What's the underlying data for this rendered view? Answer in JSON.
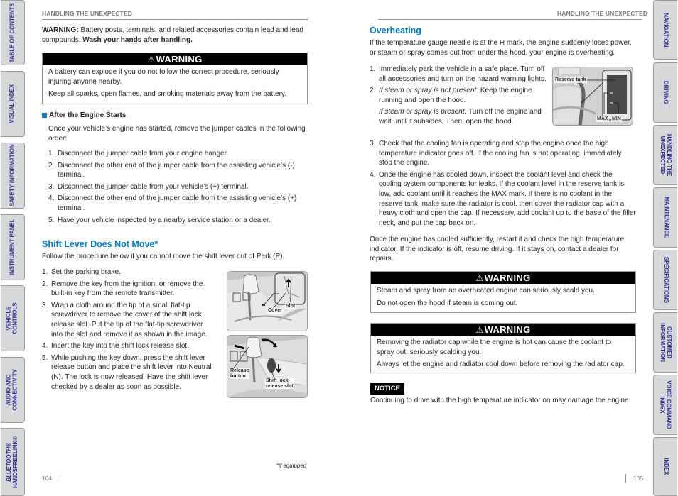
{
  "left_tabs": [
    {
      "label": "TABLE OF CONTENTS"
    },
    {
      "label": "VISUAL INDEX"
    },
    {
      "label": "SAFETY INFORMATION"
    },
    {
      "label": "INSTRUMENT PANEL"
    },
    {
      "label": "VEHICLE\nCONTROLS"
    },
    {
      "label": "AUDIO AND\nCONNECTIVITY"
    },
    {
      "label_italic": "BLUETOOTH®",
      "label": "HANDSFREELINK®"
    }
  ],
  "right_tabs": [
    {
      "label": "NAVIGATION"
    },
    {
      "label": "DRIVING"
    },
    {
      "label": "HANDLING THE\nUNEXPECTED"
    },
    {
      "label": "MAINTENANCE"
    },
    {
      "label": "SPECIFICATIONS"
    },
    {
      "label": "CUSTOMER\nINFORMATION"
    },
    {
      "label": "VOICE COMMAND\nINDEX"
    },
    {
      "label": "INDEX"
    }
  ],
  "left_page": {
    "running_head": "HANDLING THE UNEXPECTED",
    "prop65": {
      "lead": "WARNING:",
      "text": " Battery posts, terminals, and related accessories contain lead and lead compounds. ",
      "bold_tail": "Wash your hands after handling."
    },
    "warning_box": {
      "icon": "⚠",
      "title": "WARNING",
      "lines": [
        "A battery can explode if you do not follow the correct procedure, seriously injuring anyone nearby.",
        "Keep all sparks, open flames, and smoking materials away from the battery."
      ]
    },
    "after_start": {
      "heading": "After the Engine Starts",
      "intro": "Once your vehicle’s engine has started, remove the jumper cables in the following order:",
      "steps": [
        "Disconnect the jumper cable from your engine hanger.",
        "Disconnect the other end of the jumper cable from the assisting vehicle’s (-) terminal.",
        "Disconnect the jumper cable from your vehicle’s (+) terminal.",
        "Disconnect the other end of the jumper cable from the assisting vehicle’s (+) terminal.",
        "Have your vehicle inspected by a nearby service station or a dealer."
      ]
    },
    "shift_lever": {
      "heading": "Shift Lever Does Not Move*",
      "intro": "Follow the procedure below if you cannot move the shift lever out of Park (P).",
      "steps": [
        "Set the parking brake.",
        "Remove the key from the ignition, or remove the built-in key from the remote transmitter.",
        "Wrap a cloth around the tip of a small flat-tip screwdriver to remove the cover of the shift lock release slot. Put the tip of the flat-tip screwdriver into the slot and remove it as shown in the image.",
        "Insert the key into the shift lock release slot.",
        "While pushing the key down, press the shift lever release button and place the shift lever into Neutral (N). The lock is now released. Have the shift lever checked by a dealer as soon as possible."
      ],
      "figure1_labels": {
        "cover": "Cover",
        "slot": "Slot"
      },
      "figure2_labels": {
        "release": "Release\nbutton",
        "slot": "Shift lock\nrelease slot"
      }
    },
    "footnote": "*if equipped",
    "page_number": "104"
  },
  "right_page": {
    "running_head": "HANDLING THE UNEXPECTED",
    "overheating": {
      "heading": "Overheating",
      "intro": "If the temperature gauge needle is at the H mark, the engine suddenly loses power, or steam or spray comes out from under the hood, your engine is overheating.",
      "step1": "Immediately park the vehicle in a safe place. Turn off all accessories and turn on the hazard warning lights.",
      "step2_a_italic": "If steam or spray is not present:",
      "step2_a": " Keep the engine running and open the hood.",
      "step2_b_italic": "If steam or spray is present:",
      "step2_b": " Turn off the engine and wait until it subsides. Then, open the hood.",
      "step3": "Check that the cooling fan is operating and stop the engine once the high temperature indicator goes off. If the cooling fan is not operating, immediately stop the engine.",
      "step4": "Once the engine has cooled down, inspect the coolant level and check the cooling system components for leaks. If the coolant level in the reserve tank is low, add coolant until it reaches the MAX mark. If there is no coolant in the reserve tank, make sure the radiator is cool, then cover the radiator cap with a heavy cloth and open the cap. If necessary, add coolant up to the base of the filler neck, and put the cap back on.",
      "outro": "Once the engine has cooled sufficiently, restart it and check the high temperature indicator. If the indicator is off, resume driving. If it stays on, contact a dealer for repairs.",
      "figure_labels": {
        "tank": "Reserve tank",
        "max": "MAX",
        "min": "MIN"
      }
    },
    "warning1": {
      "icon": "⚠",
      "title": "WARNING",
      "lines": [
        "Steam and spray from an overheated engine can seriously scald you.",
        "Do not open the hood if steam is coming out."
      ]
    },
    "warning2": {
      "icon": "⚠",
      "title": "WARNING",
      "lines": [
        "Removing the radiator cap while the engine is hot can cause the coolant to spray out, seriously scalding you.",
        "Always let the engine and radiator cool down before removing the radiator cap."
      ]
    },
    "notice": {
      "label": "NOTICE",
      "text": "Continuing to drive with the high temperature indicator on may damage the engine."
    },
    "page_number": "105"
  }
}
